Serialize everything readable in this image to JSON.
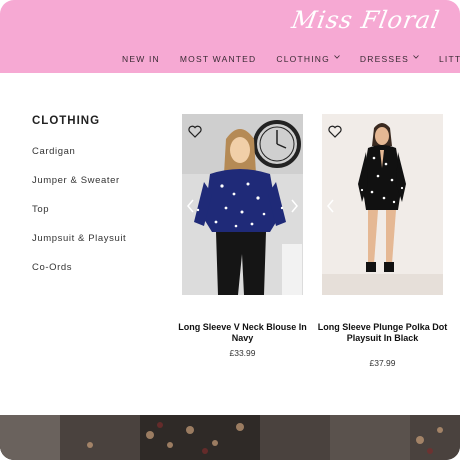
{
  "brand": {
    "logo_text": "Miss Floral"
  },
  "nav": {
    "items": [
      {
        "label": "NEW IN",
        "has_dropdown": false
      },
      {
        "label": "MOST WANTED",
        "has_dropdown": false
      },
      {
        "label": "CLOTHING",
        "has_dropdown": true
      },
      {
        "label": "DRESSES",
        "has_dropdown": true
      },
      {
        "label": "LITTLE BLACK DRESS",
        "has_dropdown": false
      }
    ]
  },
  "mega_menu": {
    "title": "CLOTHING",
    "links": [
      "Cardigan",
      "Jumper & Sweater",
      "Top",
      "Jumpsuit & Playsuit",
      "Co-Ords"
    ]
  },
  "products": [
    {
      "name": "Long Sleeve V Neck Blouse In Navy",
      "price": "£33.99",
      "icon": "heart-icon"
    },
    {
      "name": "Long Sleeve Plunge Polka Dot Playsuit In Black",
      "price": "£37.99",
      "icon": "heart-icon"
    }
  ],
  "colors": {
    "header_pink": "#f6a9d3",
    "navy": "#1f2a78",
    "black": "#111111"
  }
}
